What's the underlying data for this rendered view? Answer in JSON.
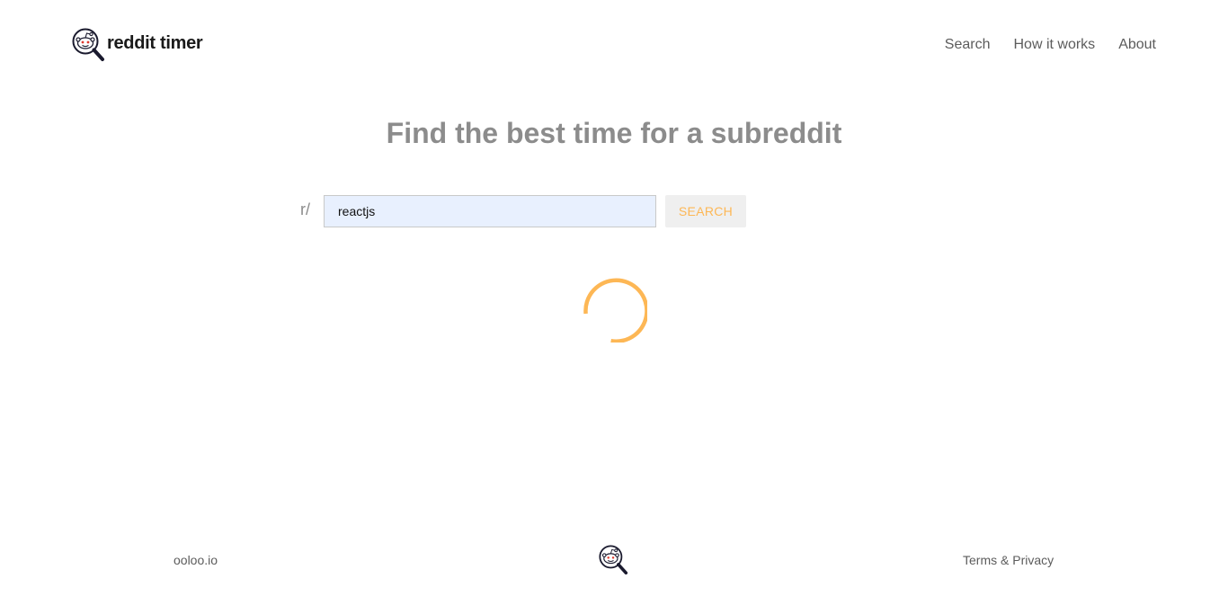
{
  "header": {
    "logo_text": "reddit timer",
    "logo_icon": "reddit-magnifier-icon",
    "nav": [
      {
        "label": "Search"
      },
      {
        "label": "How it works"
      },
      {
        "label": "About"
      }
    ]
  },
  "main": {
    "title": "Find the best time for a subreddit",
    "search": {
      "prefix": "r/",
      "value": "reactjs",
      "button_label": "SEARCH"
    },
    "loading": true
  },
  "footer": {
    "left_link": "ooloo.io",
    "logo_icon": "reddit-magnifier-icon",
    "right_link": "Terms & Privacy"
  },
  "colors": {
    "accent": "#fdb755",
    "title": "#8c8c8c",
    "nav_text": "#5c5c5c",
    "input_bg": "#e8f0fe",
    "button_bg": "#efefef"
  }
}
